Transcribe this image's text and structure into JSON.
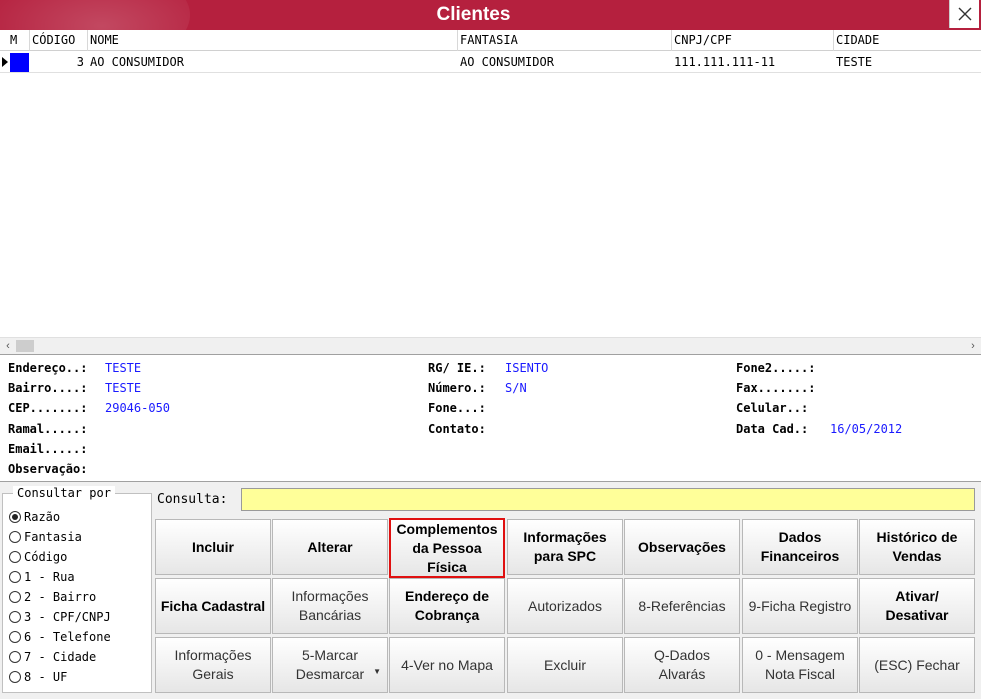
{
  "window": {
    "title": "Clientes"
  },
  "grid": {
    "columns": [
      "M",
      "CÓDIGO",
      "NOME",
      "FANTASIA",
      "CNPJ/CPF",
      "CIDADE"
    ],
    "rows": [
      {
        "codigo": "3",
        "nome": "AO CONSUMIDOR",
        "fantasia": "AO CONSUMIDOR",
        "cnpj": "111.111.111-11",
        "cidade": "TESTE"
      }
    ]
  },
  "details": {
    "endereco_label": "Endereço..:",
    "endereco": "TESTE",
    "bairro_label": "Bairro....:",
    "bairro": "TESTE",
    "cep_label": "CEP.......:",
    "cep": "29046-050",
    "ramal_label": "Ramal.....:",
    "email_label": "Email.....:",
    "obs_label": "Observação:",
    "rg_label": "RG/ IE.:",
    "rg": "ISENTO",
    "numero_label": "Número.:",
    "numero": "S/N",
    "fone_label": "Fone...:",
    "contato_label": "Contato:",
    "fone2_label": "Fone2.....:",
    "fax_label": "Fax.......:",
    "celular_label": "Celular..:",
    "datacad_label": "Data Cad.:",
    "datacad": "16/05/2012"
  },
  "consultar_por": {
    "title": "Consultar por",
    "options": [
      "Razão",
      "Fantasia",
      "Código",
      "1 - Rua",
      "2 - Bairro",
      "3 - CPF/CNPJ",
      "6 - Telefone",
      "7 - Cidade",
      "8 - UF"
    ],
    "selected": "Razão"
  },
  "consulta": {
    "label": "Consulta:",
    "value": ""
  },
  "buttons": {
    "incluir": "Incluir",
    "alterar": "Alterar",
    "complementos": "Complementos\nda Pessoa\nFísica",
    "info_spc": "Informações\npara SPC",
    "observacoes": "Observações",
    "dados_financeiros": "Dados\nFinanceiros",
    "historico_vendas": "Histórico de\nVendas",
    "ficha_cadastral": "Ficha Cadastral",
    "info_bancarias": "Informações\nBancárias",
    "endereco_cobranca": "Endereço de\nCobrança",
    "autorizados": "Autorizados",
    "referencias": "8-Referências",
    "ficha_registro": "9-Ficha Registro",
    "ativar_desativar": "Ativar/\nDesativar",
    "info_gerais": "Informações\nGerais",
    "marcar_desmarcar": "5-Marcar\nDesmarcar",
    "ver_mapa": "4-Ver no Mapa",
    "excluir": "Excluir",
    "dados_alvaras": "Q-Dados\nAlvarás",
    "mensagem_nf": "0 - Mensagem\nNota Fiscal",
    "fechar": "(ESC) Fechar"
  }
}
